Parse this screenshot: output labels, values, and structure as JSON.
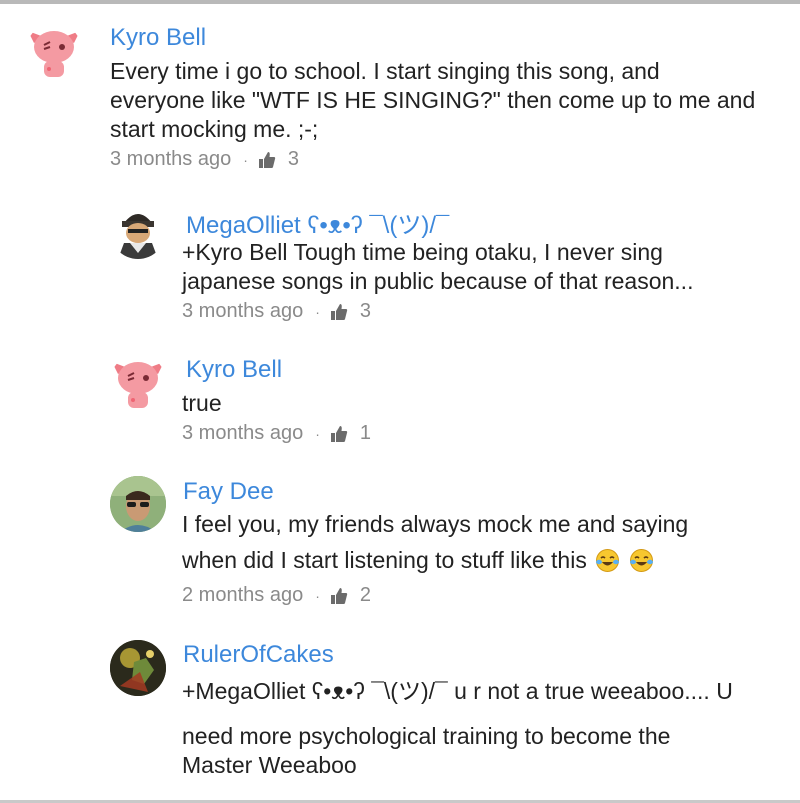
{
  "comments": [
    {
      "author": "Kyro Bell",
      "lines": [
        "Every time i go to school. I start singing this song, and",
        "everyone like \"WTF IS HE SINGING?\" then come up to me and",
        "start mocking me. ;-;"
      ],
      "time": "3 months ago",
      "likes": "3",
      "avatar": "pink-cartoon-avatar"
    },
    {
      "author": "MegaOlliet ʕ•ᴥ•ʔ ¯\\(ツ)/¯",
      "lines": [
        "+Kyro Bell Tough time being otaku, I never sing",
        "japanese songs in public because of that reason..."
      ],
      "time": "3 months ago",
      "likes": "3",
      "avatar": "beanie-character-avatar"
    },
    {
      "author": "Kyro Bell",
      "lines": [
        "true"
      ],
      "time": "3 months ago",
      "likes": "1",
      "avatar": "pink-cartoon-avatar"
    },
    {
      "author": "Fay Dee",
      "lines": [
        "I feel you, my friends always mock me and saying",
        "when did I start listening to stuff like this"
      ],
      "emojis": [
        "tears-of-joy-emoji",
        "tears-of-joy-emoji"
      ],
      "time": "2 months ago",
      "likes": "2",
      "avatar": "sunglasses-photo-avatar"
    },
    {
      "author": "RulerOfCakes",
      "lines": [
        "+MegaOlliet ʕ•ᴥ•ʔ ¯\\(ツ)/¯ u r not a true weeaboo.... U",
        "need more psychological training to become the",
        "Master Weeaboo"
      ],
      "avatar": "dark-game-art-avatar"
    }
  ],
  "separator": "·",
  "colors": {
    "author": "#3d88db",
    "meta": "#8a8a8a",
    "text": "#222222"
  }
}
